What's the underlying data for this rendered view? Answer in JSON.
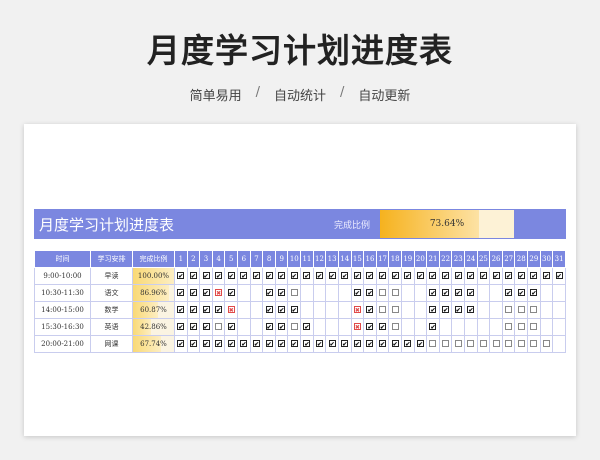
{
  "hero": {
    "title": "月度学习计划进度表",
    "tags": [
      "简单易用",
      "自动统计",
      "自动更新"
    ],
    "separator": "/"
  },
  "sheet": {
    "title": "月度学习计划进度表",
    "completion_label": "完成比例",
    "completion_value": "73.64%",
    "completion_fraction": 0.7364
  },
  "table": {
    "headers": [
      "时间",
      "学习安排",
      "完成比例"
    ],
    "days": [
      "1",
      "2",
      "3",
      "4",
      "5",
      "6",
      "7",
      "8",
      "9",
      "10",
      "11",
      "12",
      "13",
      "14",
      "15",
      "16",
      "17",
      "18",
      "19",
      "20",
      "21",
      "22",
      "23",
      "24",
      "25",
      "26",
      "27",
      "28",
      "29",
      "30",
      "31"
    ],
    "rows": [
      {
        "time": "9:00-10:00",
        "task": "早读",
        "ratio": "100.00%",
        "fraction": 1.0,
        "marks": "vvvvvvvvvvvvvvvvvvvvvvvvvvvvvvv"
      },
      {
        "time": "10:30-11:30",
        "task": "语文",
        "ratio": "86.96%",
        "fraction": 0.8696,
        "marks": "vvvxv--vvo----vvoo--vvvv--vvv--"
      },
      {
        "time": "14:00-15:00",
        "task": "数学",
        "ratio": "60.87%",
        "fraction": 0.6087,
        "marks": "vvvvx--vvv----xvoo--vvvv--ooo--"
      },
      {
        "time": "15:30-16:30",
        "task": "英语",
        "ratio": "42.86%",
        "fraction": 0.4286,
        "marks": "vvvov--vvov---xvvo--v-----ooo--"
      },
      {
        "time": "20:00-21:00",
        "task": "网课",
        "ratio": "67.74%",
        "fraction": 0.6774,
        "marks": "vvvvvvvvvvvvvvvvvvvvoooooooooo-"
      }
    ]
  },
  "marks_legend": {
    "v": "✔",
    "x": "✖",
    "o": "",
    "-": ""
  }
}
